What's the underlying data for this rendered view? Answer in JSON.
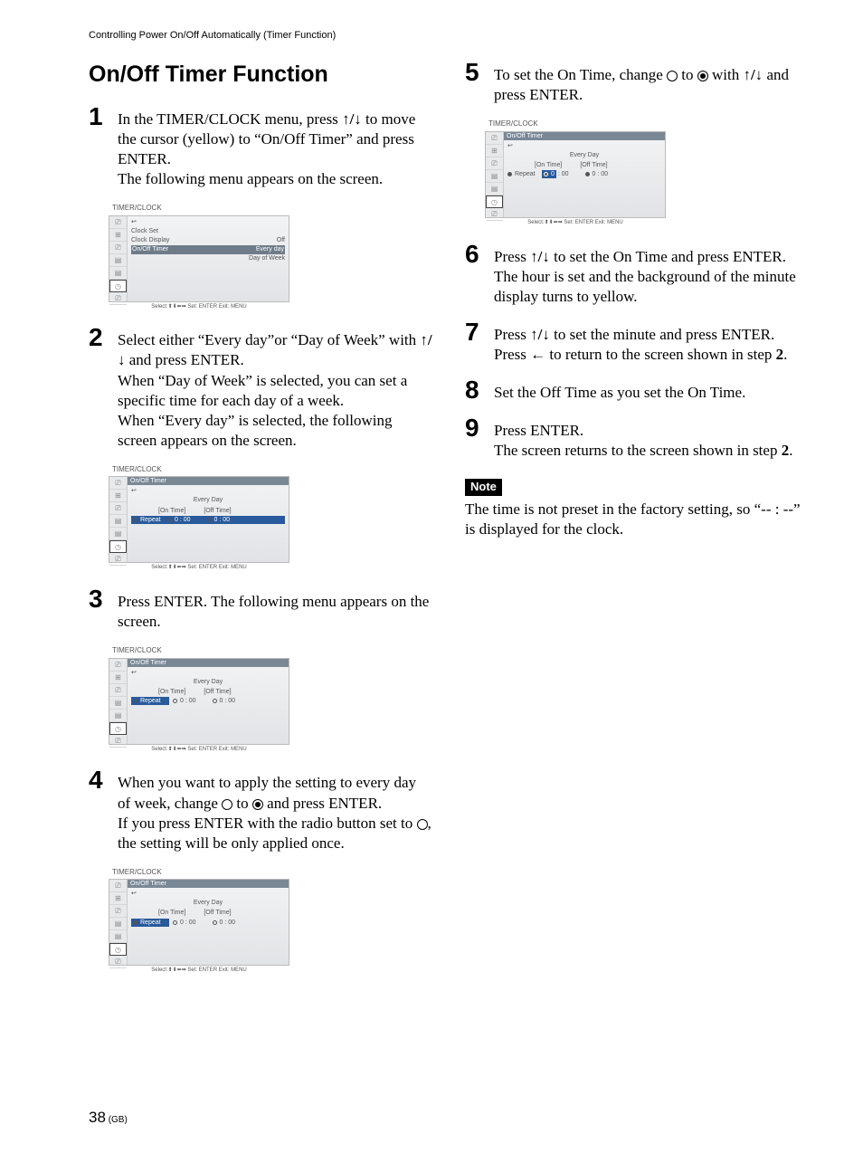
{
  "header": "Controlling Power On/Off Automatically (Timer Function)",
  "title": "On/Off Timer Function",
  "steps": {
    "s1": {
      "num": "1",
      "p1a": "In the TIMER/CLOCK menu, press ",
      "p1b": " to move the cursor (yellow) to “On/Off Timer” and press ENTER.",
      "p2": "The following menu appears on the screen."
    },
    "s2": {
      "num": "2",
      "p1a": "Select either “Every day”or “Day of Week” with ",
      "p1b": " and press ENTER.",
      "p2": "When “Day of Week” is selected, you can set a specific time for each day of a week.",
      "p3": "When “Every day” is selected, the following screen appears on the screen."
    },
    "s3": {
      "num": "3",
      "p1": "Press ENTER. The following menu appears on the screen."
    },
    "s4": {
      "num": "4",
      "p1a": "When you want to apply the setting to every day of week, change ",
      "p1b": " to ",
      "p1c": " and press ENTER.",
      "p2a": "If you press ENTER with the radio button set to ",
      "p2b": ", the setting will be only applied once."
    },
    "s5": {
      "num": "5",
      "p1a": "To set the On Time, change ",
      "p1b": " to ",
      "p1c": " with ",
      "p1d": " and press ENTER."
    },
    "s6": {
      "num": "6",
      "p1a": "Press ",
      "p1b": " to set the On Time and press ENTER. The hour is set and the background of the minute display turns to yellow."
    },
    "s7": {
      "num": "7",
      "p1a": "Press ",
      "p1b": " to set the minute and press ENTER. Press ",
      "p1c": " to return to the screen shown in step "
    },
    "s8": {
      "num": "8",
      "p1": "Set the Off Time as you set the On Time."
    },
    "s9": {
      "num": "9",
      "p1": "Press ENTER.",
      "p2a": "The screen returns to the screen shown in step "
    },
    "boldref2": "2",
    "period": "."
  },
  "note": {
    "label": "Note",
    "text": "The time is not preset in the factory setting, so “-- : --” is displayed for the clock."
  },
  "screenshot": {
    "title": "TIMER/CLOCK",
    "back": "↩",
    "clock_set": "Clock Set",
    "clock_display": "Clock Display",
    "off": "Off",
    "onoff_timer": "On/Off Timer",
    "every_day": "Every day",
    "day_of_week": "Day of Week",
    "submenu_title": "On/Off Timer",
    "every_day_label": "Every Day",
    "on_time": "[On Time]",
    "off_time": "[Off Time]",
    "repeat": "Repeat",
    "zero_colon_zero": "0 : 00",
    "footer": "Select:⬆⬇⬅➡   Set: ENTER   Exit: MENU"
  },
  "page": {
    "num": "38",
    "gb": " (GB)"
  }
}
